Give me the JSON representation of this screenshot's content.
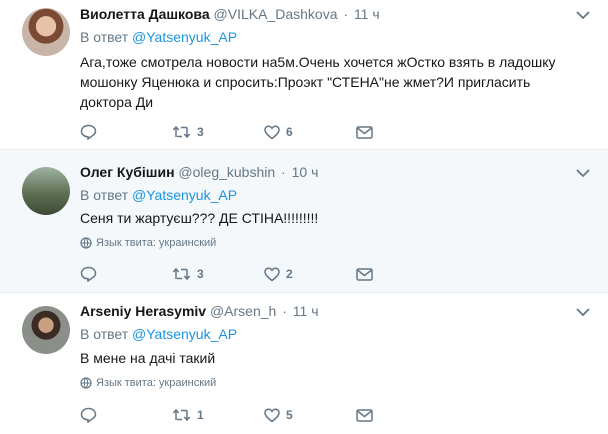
{
  "tweets": [
    {
      "name": "Виолетта Дашкова",
      "handle": "@VILKA_Dashkova",
      "time": "11 ч",
      "reply_prefix": "В ответ",
      "reply_handle": "@Yatsenyuk_AP",
      "text": "Ага,тоже смотрела новости на5м.Очень хочется жОстко взять в ладошку мошонку Яценюка и спросить:Проэкт \"СТЕНА\"не жмет?И пригласить доктора Ди",
      "lang": "",
      "retweets": "3",
      "likes": "6"
    },
    {
      "name": "Олег Кубішин",
      "handle": "@oleg_kubshin",
      "time": "10 ч",
      "reply_prefix": "В ответ",
      "reply_handle": "@Yatsenyuk_AP",
      "text": "Сеня ти жартуєш??? ДЕ СТІНА!!!!!!!!!",
      "lang": "Язык твита: украинский",
      "retweets": "3",
      "likes": "2"
    },
    {
      "name": "Arseniy Herasymiv",
      "handle": "@Arsen_h",
      "time": "11 ч",
      "reply_prefix": "В ответ",
      "reply_handle": "@Yatsenyuk_AP",
      "text": "В мене на дачі такий",
      "lang": "Язык твита: украинский",
      "retweets": "1",
      "likes": "5"
    }
  ],
  "icons": {
    "reply": "reply-icon",
    "retweet": "retweet-icon",
    "like": "heart-icon",
    "dm": "envelope-icon",
    "more": "chevron-down-icon",
    "language": "globe-icon"
  },
  "colors": {
    "link": "#1b95e0",
    "muted": "#657786",
    "text": "#14171a",
    "hover_bg": "#f5f8fa"
  }
}
